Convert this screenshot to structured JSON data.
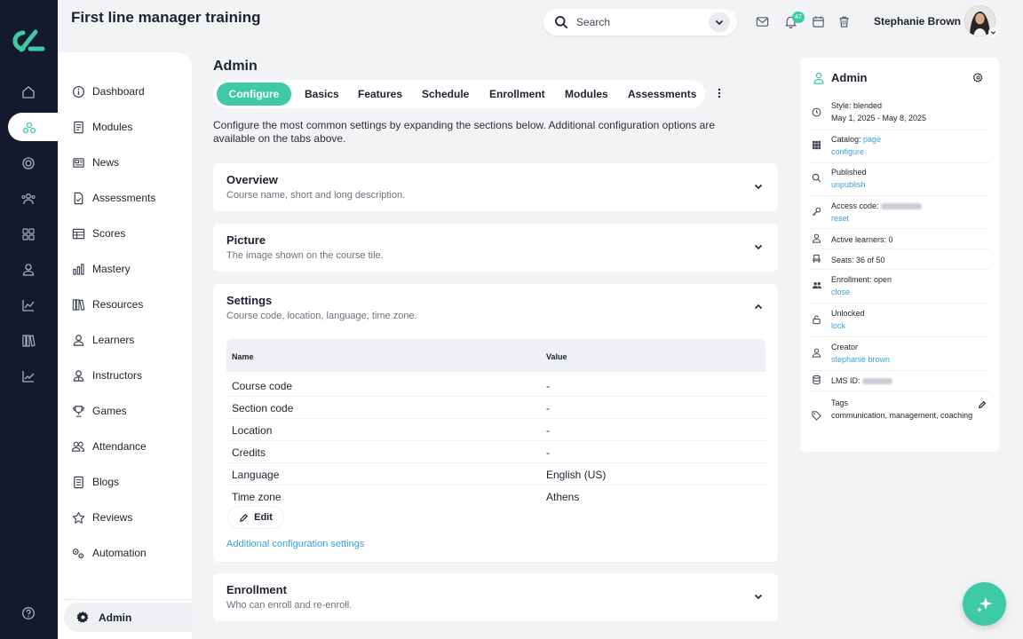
{
  "app": {
    "title": "First line manager training"
  },
  "search": {
    "placeholder": "Search"
  },
  "header": {
    "notif_count": "47",
    "user_name": "Stephanie Brown"
  },
  "rail": {
    "icons": [
      "logo-icon",
      "home-icon",
      "modules-icon",
      "target-icon",
      "people-icon",
      "grid-icon",
      "user-icon",
      "chart-icon",
      "library-icon",
      "trend-icon",
      "help-icon"
    ]
  },
  "nav": {
    "items": [
      {
        "label": "Dashboard",
        "icon": "dashboard-icon"
      },
      {
        "label": "Modules",
        "icon": "modules-icon"
      },
      {
        "label": "News",
        "icon": "news-icon"
      },
      {
        "label": "Assessments",
        "icon": "assessments-icon"
      },
      {
        "label": "Scores",
        "icon": "scores-icon"
      },
      {
        "label": "Mastery",
        "icon": "mastery-icon"
      },
      {
        "label": "Resources",
        "icon": "resources-icon"
      },
      {
        "label": "Learners",
        "icon": "learners-icon"
      },
      {
        "label": "Instructors",
        "icon": "instructors-icon"
      },
      {
        "label": "Games",
        "icon": "games-icon"
      },
      {
        "label": "Attendance",
        "icon": "attendance-icon"
      },
      {
        "label": "Blogs",
        "icon": "blogs-icon"
      },
      {
        "label": "Reviews",
        "icon": "reviews-icon"
      },
      {
        "label": "Automation",
        "icon": "automation-icon"
      }
    ],
    "admin": "Admin"
  },
  "main": {
    "title": "Admin",
    "tabs": [
      "Configure",
      "Basics",
      "Features",
      "Schedule",
      "Enrollment",
      "Modules",
      "Assessments"
    ],
    "intro": "Configure the most common settings by expanding the sections below. Additional configuration options are available on the tabs above.",
    "sections": {
      "overview": {
        "title": "Overview",
        "subtitle": "Course name, short and long description."
      },
      "picture": {
        "title": "Picture",
        "subtitle": "The image shown on the course tile."
      },
      "settings": {
        "title": "Settings",
        "subtitle": "Course code, location, language, time zone.",
        "headers": {
          "name": "Name",
          "value": "Value"
        },
        "rows": [
          {
            "name": "Course code",
            "value": "-"
          },
          {
            "name": "Section code",
            "value": "-"
          },
          {
            "name": "Location",
            "value": "-"
          },
          {
            "name": "Credits",
            "value": "-"
          },
          {
            "name": "Language",
            "value": "English (US)"
          },
          {
            "name": "Time zone",
            "value": "Athens"
          }
        ],
        "edit": "Edit",
        "additional_link": "Additional configuration settings"
      },
      "enrollment": {
        "title": "Enrollment",
        "subtitle": "Who can enroll and re-enroll."
      }
    }
  },
  "panel": {
    "title": "Admin",
    "style": "Style: blended",
    "dates": "May 1, 2025 - May 8, 2025",
    "catalog": "Catalog:",
    "catalog_link": "page",
    "catalog_configure": "configure",
    "published": "Published",
    "unpublish": "unpublish",
    "access_code": "Access code:",
    "reset": "reset",
    "active_learners": "Active learners: 0",
    "seats": "Seats: 36 of 50",
    "enrollment": "Enrollment: open",
    "close": "close",
    "unlocked": "Unlocked",
    "lock": "lock",
    "creator": "Creator",
    "creator_link": "stephanie brown",
    "lms_id": "LMS ID:",
    "tags": "Tags",
    "tags_value": "communication, management, coaching"
  },
  "colors": {
    "accent": "#3ec9a7",
    "rail": "#141a2d",
    "link": "#3ba0d8"
  }
}
